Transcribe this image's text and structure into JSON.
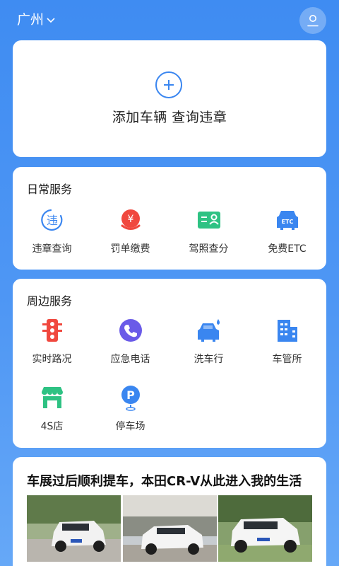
{
  "header": {
    "city": "广州",
    "city_icon": "chevron-down-icon",
    "profile_icon": "user-icon"
  },
  "add_vehicle": {
    "icon": "plus-circle-icon",
    "label": "添加车辆 查询违章"
  },
  "daily_services": {
    "title": "日常服务",
    "items": [
      {
        "label": "违章查询",
        "icon": "violation-icon"
      },
      {
        "label": "罚单缴费",
        "icon": "fine-payment-icon"
      },
      {
        "label": "驾照查分",
        "icon": "license-points-icon"
      },
      {
        "label": "免费ETC",
        "icon": "etc-icon"
      }
    ]
  },
  "nearby_services": {
    "title": "周边服务",
    "items": [
      {
        "label": "实时路况",
        "icon": "traffic-light-icon"
      },
      {
        "label": "应急电话",
        "icon": "phone-icon"
      },
      {
        "label": "洗车行",
        "icon": "car-wash-icon"
      },
      {
        "label": "车管所",
        "icon": "building-icon"
      },
      {
        "label": "4S店",
        "icon": "store-icon"
      },
      {
        "label": "停车场",
        "icon": "parking-icon"
      }
    ]
  },
  "article": {
    "title": "车展过后顺利提车，本田CR-V从此进入我的生活",
    "photos": [
      "car-photo",
      "car-photo",
      "car-photo"
    ]
  },
  "colors": {
    "background": "#3f8cf2",
    "accent": "#3a86f0",
    "red": "#f0483e",
    "green": "#2ec283",
    "purple": "#6a5be8"
  }
}
